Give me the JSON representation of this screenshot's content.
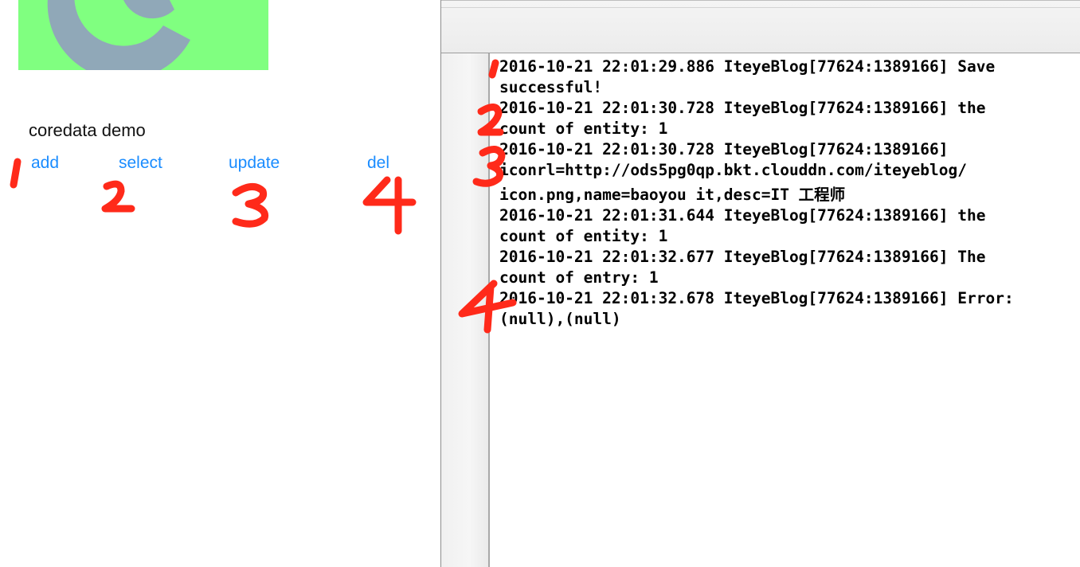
{
  "app": {
    "title": "coredata demo",
    "buttons": {
      "add": "add",
      "select": "select",
      "update": "update",
      "del": "del"
    },
    "icon_colors": {
      "background": "#80ff80",
      "glyph": "#90a8b8"
    }
  },
  "console": {
    "lines": [
      "2016-10-21 22:01:29.886 IteyeBlog[77624:1389166] Save",
      "successful!",
      "2016-10-21 22:01:30.728 IteyeBlog[77624:1389166] the",
      "count of entity: 1",
      "2016-10-21 22:01:30.728 IteyeBlog[77624:1389166]",
      "iconrl=http://ods5pg0qp.bkt.clouddn.com/iteyeblog/",
      "icon.png,name=baoyou it,desc=IT 工程师",
      "2016-10-21 22:01:31.644 IteyeBlog[77624:1389166] the",
      "count of entity: 1",
      "2016-10-21 22:01:32.677 IteyeBlog[77624:1389166] The",
      "count of entry: 1",
      "2016-10-21 22:01:32.678 IteyeBlog[77624:1389166] Error:",
      "(null),(null)"
    ]
  },
  "annotation_color": "#ff2a1a"
}
